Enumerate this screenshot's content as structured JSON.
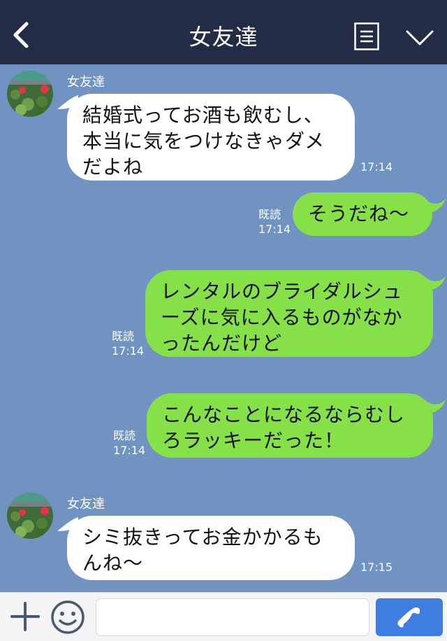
{
  "header": {
    "title": "女友達"
  },
  "messages": [
    {
      "side": "in",
      "sender": "女友達",
      "lines": [
        "結婚式ってお酒も飲むし、",
        "本当に気をつけなきゃダメ",
        "だよね"
      ],
      "time": "17:14"
    },
    {
      "side": "out",
      "read": "既読",
      "lines": [
        "そうだね〜"
      ],
      "time": "17:14"
    },
    {
      "side": "out",
      "read": "既読",
      "lines": [
        "レンタルのブライダルシュ",
        "ーズに気に入るものがなか",
        "ったんだけど"
      ],
      "time": "17:14"
    },
    {
      "side": "out",
      "read": "既読",
      "lines": [
        "こんなことになるならむし",
        "ろラッキーだった！"
      ],
      "time": "17:14"
    },
    {
      "side": "in",
      "sender": "女友達",
      "lines": [
        "シミ抜きってお金かかるも",
        "んね〜"
      ],
      "time": "17:15"
    }
  ],
  "footer": {
    "input_value": ""
  },
  "icons": {
    "back": "chevron-left-icon",
    "menu": "menu-icon",
    "collapse": "chevron-down-icon",
    "plus": "plus-icon",
    "emoji": "emoji-icon",
    "call": "phone-icon"
  },
  "colors": {
    "header": "#232c46",
    "background": "#7193c1",
    "incoming_bubble": "#ffffff",
    "outgoing_bubble": "#86e149",
    "call_button": "#3f7ee0"
  }
}
